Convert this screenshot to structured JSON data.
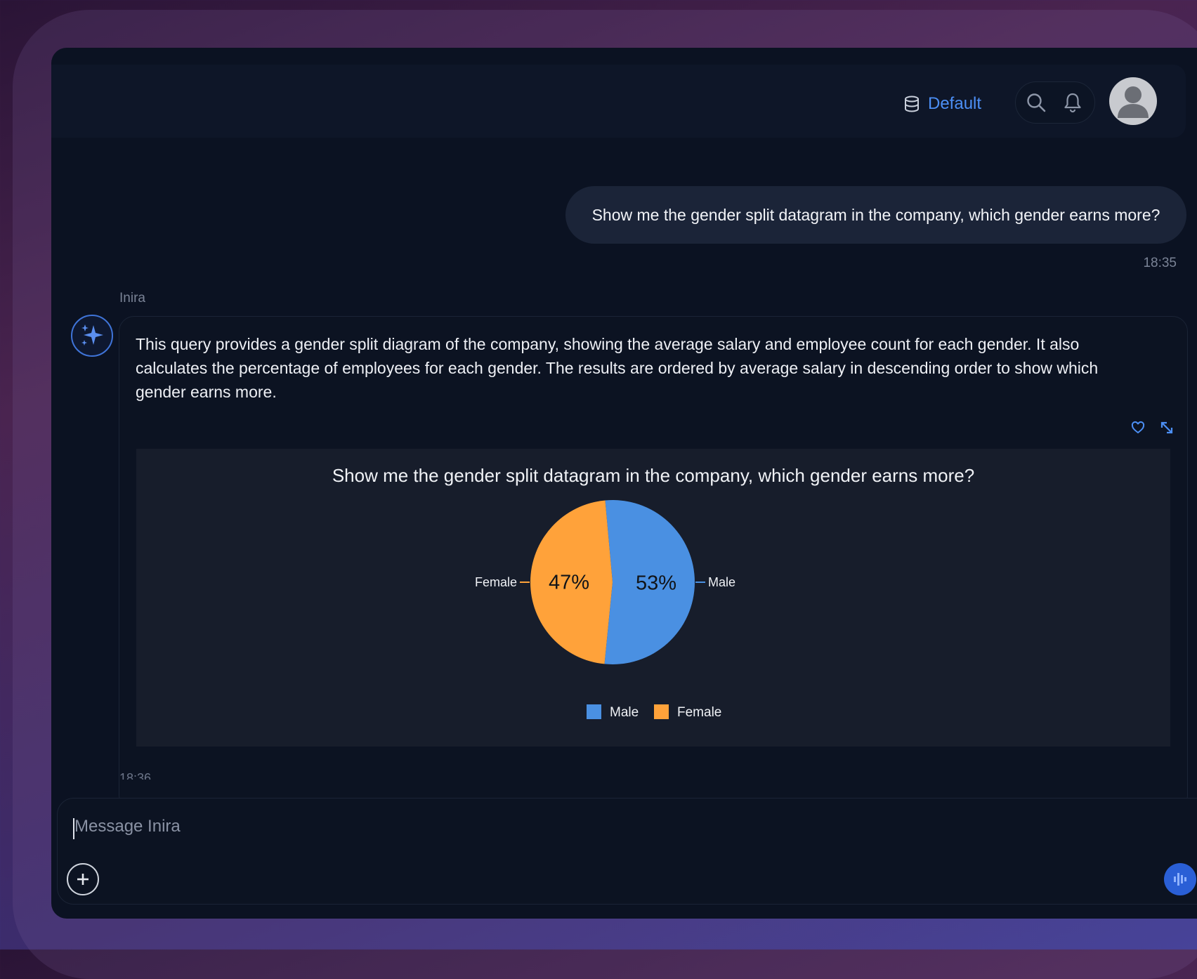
{
  "header": {
    "database_label": "Default",
    "icons": [
      "database-icon",
      "search-icon",
      "bell-icon",
      "user-avatar"
    ]
  },
  "conversation": {
    "user_message": "Show me the gender split datagram in the company, which gender earns more?",
    "user_timestamp": "18:35",
    "bot_name": "Inira",
    "bot_message": "This query provides a gender split diagram of the company, showing the average salary and employee count for each gender. It also calculates the percentage of employees for each gender. The results are ordered by average salary in descending order to show which gender earns more.",
    "bot_timestamp": "18:36"
  },
  "composer": {
    "placeholder": "Message Inira"
  },
  "colors": {
    "accent": "#4c8ff5",
    "male": "#4a90e2",
    "female": "#ffa23a"
  },
  "chart_data": {
    "type": "pie",
    "title": "Show me the gender split datagram in the company, which gender earns more?",
    "categories": [
      "Male",
      "Female"
    ],
    "values": [
      53,
      47
    ],
    "labels": [
      "53%",
      "47%"
    ],
    "colors": [
      "#4a90e2",
      "#ffa23a"
    ],
    "legend": [
      "Male",
      "Female"
    ],
    "legend_position": "bottom"
  }
}
